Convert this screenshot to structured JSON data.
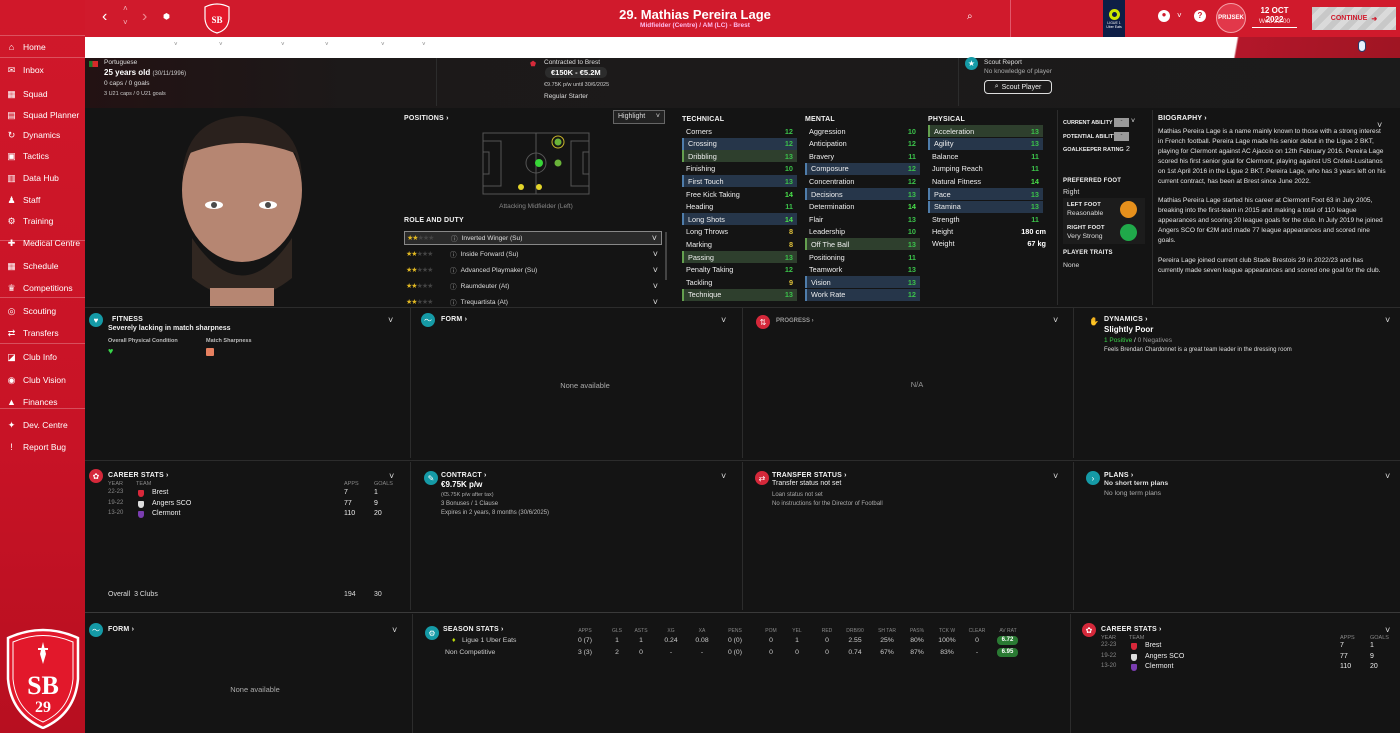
{
  "sidebar": {
    "items": [
      {
        "label": "Home",
        "icon": "home-icon"
      },
      {
        "label": "Inbox",
        "icon": "inbox-icon"
      },
      {
        "label": "Squad",
        "icon": "squad-icon"
      },
      {
        "label": "Squad Planner",
        "icon": "clipboard-icon"
      },
      {
        "label": "Dynamics",
        "icon": "dynamics-icon"
      },
      {
        "label": "Tactics",
        "icon": "tactics-icon"
      },
      {
        "label": "Data Hub",
        "icon": "data-hub-icon"
      },
      {
        "label": "Staff",
        "icon": "staff-icon"
      },
      {
        "label": "Training",
        "icon": "training-icon"
      },
      {
        "label": "Medical Centre",
        "icon": "medical-icon"
      },
      {
        "label": "Schedule",
        "icon": "calendar-icon"
      },
      {
        "label": "Competitions",
        "icon": "trophy-icon"
      },
      {
        "label": "Scouting",
        "icon": "scouting-icon"
      },
      {
        "label": "Transfers",
        "icon": "transfers-icon"
      },
      {
        "label": "Club Info",
        "icon": "club-info-icon"
      },
      {
        "label": "Club Vision",
        "icon": "club-vision-icon"
      },
      {
        "label": "Finances",
        "icon": "finances-icon"
      },
      {
        "label": "Dev. Centre",
        "icon": "dev-centre-icon"
      },
      {
        "label": "Report Bug",
        "icon": "report-bug-icon"
      }
    ],
    "crest_text": "SB",
    "crest_num": "29"
  },
  "header": {
    "player_title": "29. Mathias Pereira Lage",
    "player_subtitle": "Midfielder (Centre) / AM (LC) - Brest",
    "league_logo_text": "LIGUE 1",
    "league_logo_sub": "Uber Eats",
    "manager_badge": "PRIJSEK",
    "date": "12 OCT 2022",
    "time": "Wed 23:00",
    "continue_label": "CONTINUE",
    "accent": "#d01a2c"
  },
  "info": {
    "nationality": "Portuguese",
    "age": "25 years old",
    "dob": "(30/11/1996)",
    "caps": "0 caps / 0 goals",
    "u21caps": "3 U21 caps / 0 U21 goals",
    "contract_label": "Contracted to Brest",
    "value_range": "€150K - €5.2M",
    "wage_until": "€9.75K p/w until 30/6/2025",
    "squad_status": "Regular Starter",
    "scout_label": "Scout Report",
    "scout_text": "No knowledge of player",
    "scout_button": "Scout Player"
  },
  "positions": {
    "title": "POSITIONS",
    "highlight_select": "Highlight",
    "selected_position": "Attacking Midfielder (Left)",
    "role_title": "ROLE AND DUTY",
    "roles": [
      {
        "name": "Inverted Winger (Su)",
        "stars": 2
      },
      {
        "name": "Inside Forward (Su)",
        "stars": 2
      },
      {
        "name": "Advanced Playmaker (Su)",
        "stars": 2
      },
      {
        "name": "Raumdeuter (At)",
        "stars": 2
      },
      {
        "name": "Trequartista (At)",
        "stars": 2
      }
    ]
  },
  "attributes": {
    "technical_title": "TECHNICAL",
    "mental_title": "MENTAL",
    "physical_title": "PHYSICAL",
    "technical": [
      {
        "name": "Corners",
        "value": "12",
        "hl": ""
      },
      {
        "name": "Crossing",
        "value": "12",
        "hl": "blue"
      },
      {
        "name": "Dribbling",
        "value": "13",
        "hl": "green"
      },
      {
        "name": "Finishing",
        "value": "10",
        "hl": ""
      },
      {
        "name": "First Touch",
        "value": "13",
        "hl": "blue"
      },
      {
        "name": "Free Kick Taking",
        "value": "14",
        "hl": ""
      },
      {
        "name": "Heading",
        "value": "11",
        "hl": ""
      },
      {
        "name": "Long Shots",
        "value": "14",
        "hl": "blue"
      },
      {
        "name": "Long Throws",
        "value": "8",
        "hl": ""
      },
      {
        "name": "Marking",
        "value": "8",
        "hl": ""
      },
      {
        "name": "Passing",
        "value": "13",
        "hl": "green"
      },
      {
        "name": "Penalty Taking",
        "value": "12",
        "hl": ""
      },
      {
        "name": "Tackling",
        "value": "9",
        "hl": ""
      },
      {
        "name": "Technique",
        "value": "13",
        "hl": "green"
      }
    ],
    "mental": [
      {
        "name": "Aggression",
        "value": "10",
        "hl": ""
      },
      {
        "name": "Anticipation",
        "value": "12",
        "hl": ""
      },
      {
        "name": "Bravery",
        "value": "11",
        "hl": ""
      },
      {
        "name": "Composure",
        "value": "12",
        "hl": "blue"
      },
      {
        "name": "Concentration",
        "value": "12",
        "hl": ""
      },
      {
        "name": "Decisions",
        "value": "13",
        "hl": "blue"
      },
      {
        "name": "Determination",
        "value": "14",
        "hl": ""
      },
      {
        "name": "Flair",
        "value": "13",
        "hl": ""
      },
      {
        "name": "Leadership",
        "value": "10",
        "hl": ""
      },
      {
        "name": "Off The Ball",
        "value": "13",
        "hl": "green"
      },
      {
        "name": "Positioning",
        "value": "11",
        "hl": ""
      },
      {
        "name": "Teamwork",
        "value": "13",
        "hl": ""
      },
      {
        "name": "Vision",
        "value": "13",
        "hl": "blue"
      },
      {
        "name": "Work Rate",
        "value": "12",
        "hl": "blue"
      }
    ],
    "physical": [
      {
        "name": "Acceleration",
        "value": "13",
        "hl": "green"
      },
      {
        "name": "Agility",
        "value": "13",
        "hl": "blue"
      },
      {
        "name": "Balance",
        "value": "11",
        "hl": ""
      },
      {
        "name": "Jumping Reach",
        "value": "11",
        "hl": ""
      },
      {
        "name": "Natural Fitness",
        "value": "14",
        "hl": ""
      },
      {
        "name": "Pace",
        "value": "13",
        "hl": "blue"
      },
      {
        "name": "Stamina",
        "value": "13",
        "hl": "blue"
      },
      {
        "name": "Strength",
        "value": "11",
        "hl": ""
      }
    ],
    "height_label": "Height",
    "height": "180 cm",
    "weight_label": "Weight",
    "weight": "67 kg"
  },
  "ability": {
    "ca_label": "CURRENT ABILITY",
    "pa_label": "POTENTIAL ABILITY",
    "gk_label": "GOALKEEPER RATING",
    "ca": "-",
    "pa": "-",
    "gk": "2",
    "foot_title": "PREFERRED FOOT",
    "foot": "Right",
    "left_foot_label": "LEFT FOOT",
    "left_foot": "Reasonable",
    "right_foot_label": "RIGHT FOOT",
    "right_foot": "Very Strong",
    "traits_title": "PLAYER TRAITS",
    "traits": "None"
  },
  "biography": {
    "title": "BIOGRAPHY",
    "paragraphs": [
      "Mathias Pereira Lage is a name mainly known to those with a strong interest in French football. Pereira Lage made his senior debut in the Ligue 2 BKT, playing for Clermont against AC Ajaccio on 12th February 2016. Pereira Lage scored his first senior goal for Clermont, playing against US Créteil-Lusitanos on 1st April 2016 in the Ligue 2 BKT. Pereira Lage, who has 3 years left on his current contract, has been at Brest since June 2022.",
      "Mathias Pereira Lage started his career at Clermont Foot 63 in July 2005, breaking into the first-team in 2015 and making a total of 110 league appearances and scoring 20 league goals for the club. In July 2019 he joined Angers SCO for €2M and made 77 league appearances and scored nine goals.",
      "Pereira Lage joined current club Stade Brestois 29 in 2022/23 and has currently made seven league appearances and scored one goal for the club."
    ]
  },
  "fitness": {
    "title": "FITNESS",
    "status": "Severely lacking in match sharpness",
    "cond_label": "Overall Physical Condition",
    "sharp_label": "Match Sharpness"
  },
  "form": {
    "title": "FORM",
    "empty": "None available"
  },
  "progress": {
    "title": "PROGRESS",
    "empty": "N/A"
  },
  "dynamics": {
    "title": "DYNAMICS",
    "status": "Slightly Poor",
    "positive": "1 Positive",
    "sep": "/",
    "negative": "0 Negatives",
    "note": "Feels Brendan Chardonnet is a great team leader in the dressing room"
  },
  "career": {
    "title": "CAREER STATS",
    "headers": {
      "year": "YEAR",
      "team": "TEAM",
      "apps": "APPS",
      "goals": "GOALS"
    },
    "rows": [
      {
        "year": "22-23",
        "team": "Brest",
        "apps": "7",
        "goals": "1"
      },
      {
        "year": "19-22",
        "team": "Angers SCO",
        "apps": "77",
        "goals": "9"
      },
      {
        "year": "13-20",
        "team": "Clermont",
        "apps": "110",
        "goals": "20"
      }
    ],
    "overall_label": "Overall",
    "overall_clubs": "3 Clubs",
    "overall_apps": "194",
    "overall_goals": "30"
  },
  "contract": {
    "title": "CONTRACT",
    "wage": "€9.75K p/w",
    "after_tax": "(€5.75K p/w after tax)",
    "bonuses": "3 Bonuses / 1 Clause",
    "expires": "Expires in 2 years, 8 months  (30/6/2025)"
  },
  "transfer": {
    "title": "TRANSFER STATUS",
    "status": "Transfer status not set",
    "loan": "Loan status not set",
    "dof": "No instructions for the Director of Football"
  },
  "plans": {
    "title": "PLANS",
    "short": "No short term plans",
    "long": "No long term plans"
  },
  "season": {
    "title": "SEASON STATS",
    "headers": [
      "APPS",
      "GLS",
      "ASTS",
      "XG",
      "XA",
      "PENS",
      "POM",
      "YEL",
      "RED",
      "DRB/90",
      "SH TAR",
      "PAS%",
      "TCK W",
      "CLEAR",
      "AV RAT"
    ],
    "rows": [
      {
        "comp": "Ligue 1 Uber Eats",
        "cells": [
          "0 (7)",
          "1",
          "1",
          "0.24",
          "0.08",
          "0 (0)",
          "0",
          "1",
          "0",
          "2.55",
          "25%",
          "80%",
          "100%",
          "0"
        ],
        "rating": "6.72"
      },
      {
        "comp": "Non Competitive",
        "cells": [
          "3 (3)",
          "2",
          "0",
          "-",
          "-",
          "0 (0)",
          "0",
          "0",
          "0",
          "0.74",
          "67%",
          "87%",
          "83%",
          "-"
        ],
        "rating": "6.95"
      }
    ]
  }
}
